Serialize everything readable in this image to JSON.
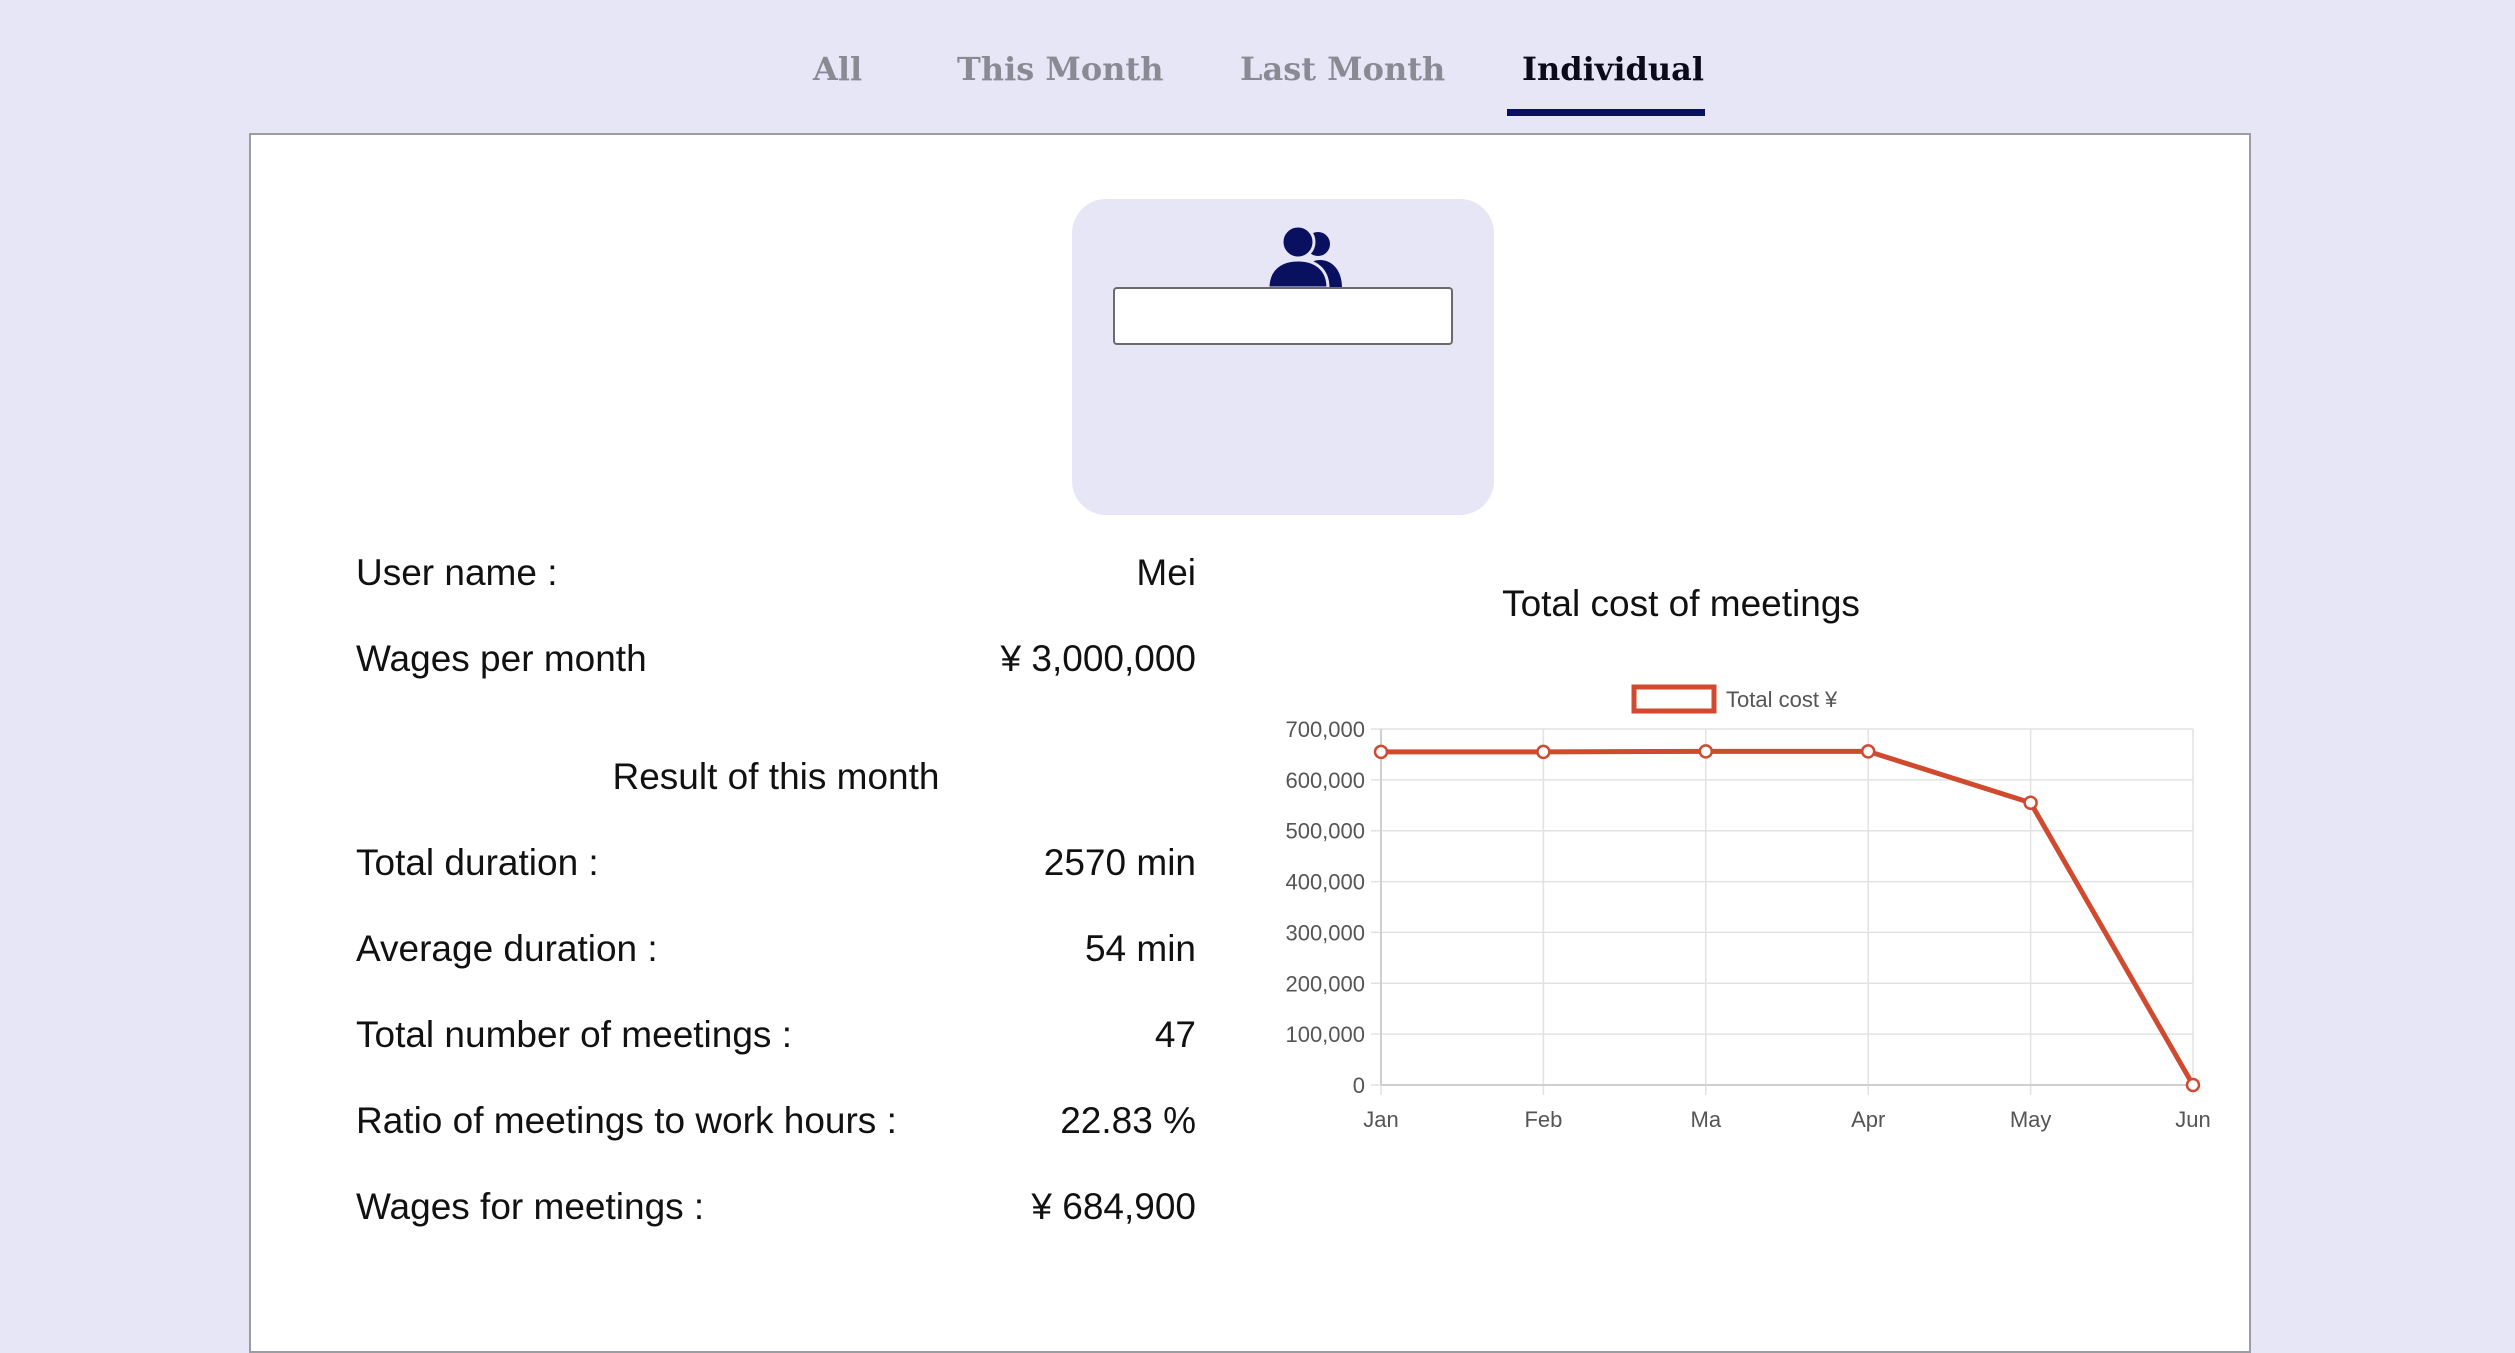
{
  "tabs": [
    {
      "label": "All",
      "active": false
    },
    {
      "label": "This Month",
      "active": false
    },
    {
      "label": "Last Month",
      "active": false
    },
    {
      "label": "Individual",
      "active": true
    }
  ],
  "profile": {
    "icon": "users-icon",
    "name_input_value": "",
    "user_name_label": "User name :",
    "user_name_value": "Mei",
    "wages_label": "Wages per month",
    "wages_value": "¥ 3,000,000"
  },
  "results": {
    "title": "Result of this month",
    "rows": [
      {
        "label": "Total duration :",
        "value": "2570 min"
      },
      {
        "label": "Average duration :",
        "value": "54 min"
      },
      {
        "label": "Total number of meetings :",
        "value": "47"
      },
      {
        "label": "Ratio of meetings to work hours :",
        "value": "22.83 %"
      },
      {
        "label": "Wages for meetings :",
        "value": "¥ 684,900"
      }
    ]
  },
  "colors": {
    "background": "#e7e6f7",
    "accent": "#0a1060",
    "series": "#d04a30"
  },
  "chart_data": {
    "type": "line",
    "title": "Total cost of meetings",
    "categories": [
      "Jan",
      "Feb",
      "Ma",
      "Apr",
      "May",
      "Jun"
    ],
    "series": [
      {
        "name": "Total cost ¥",
        "values": [
          655000,
          655000,
          656000,
          656000,
          555000,
          0
        ]
      }
    ],
    "y_ticks": [
      "700,000",
      "600,000",
      "500,000",
      "400,000",
      "300,000",
      "200,000",
      "100,000",
      "0"
    ],
    "ylim": [
      0,
      700000
    ],
    "grid": true,
    "legend": "top-center"
  }
}
